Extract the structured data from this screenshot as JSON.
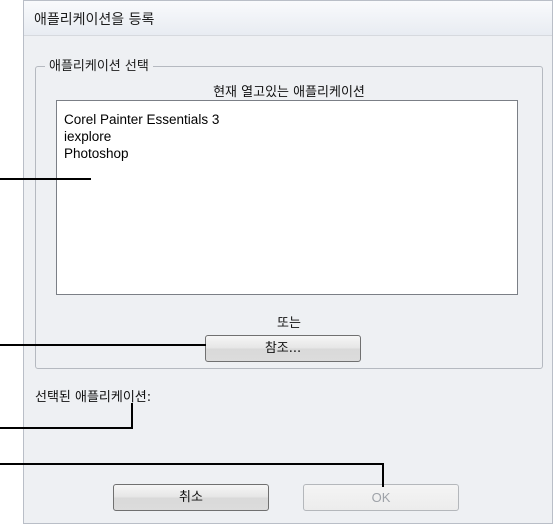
{
  "dialog": {
    "title": "애플리케이션을 등록"
  },
  "group": {
    "legend": "애플리케이션 선택",
    "open_apps_label": "현재 열고있는 애플리케이션",
    "apps": [
      "Corel Painter Essentials 3",
      "iexplore",
      "Photoshop"
    ],
    "or_label": "또는",
    "browse_button": "참조..."
  },
  "selected_label": "선택된 애플리케이션:",
  "buttons": {
    "cancel": "취소",
    "ok": "OK"
  }
}
